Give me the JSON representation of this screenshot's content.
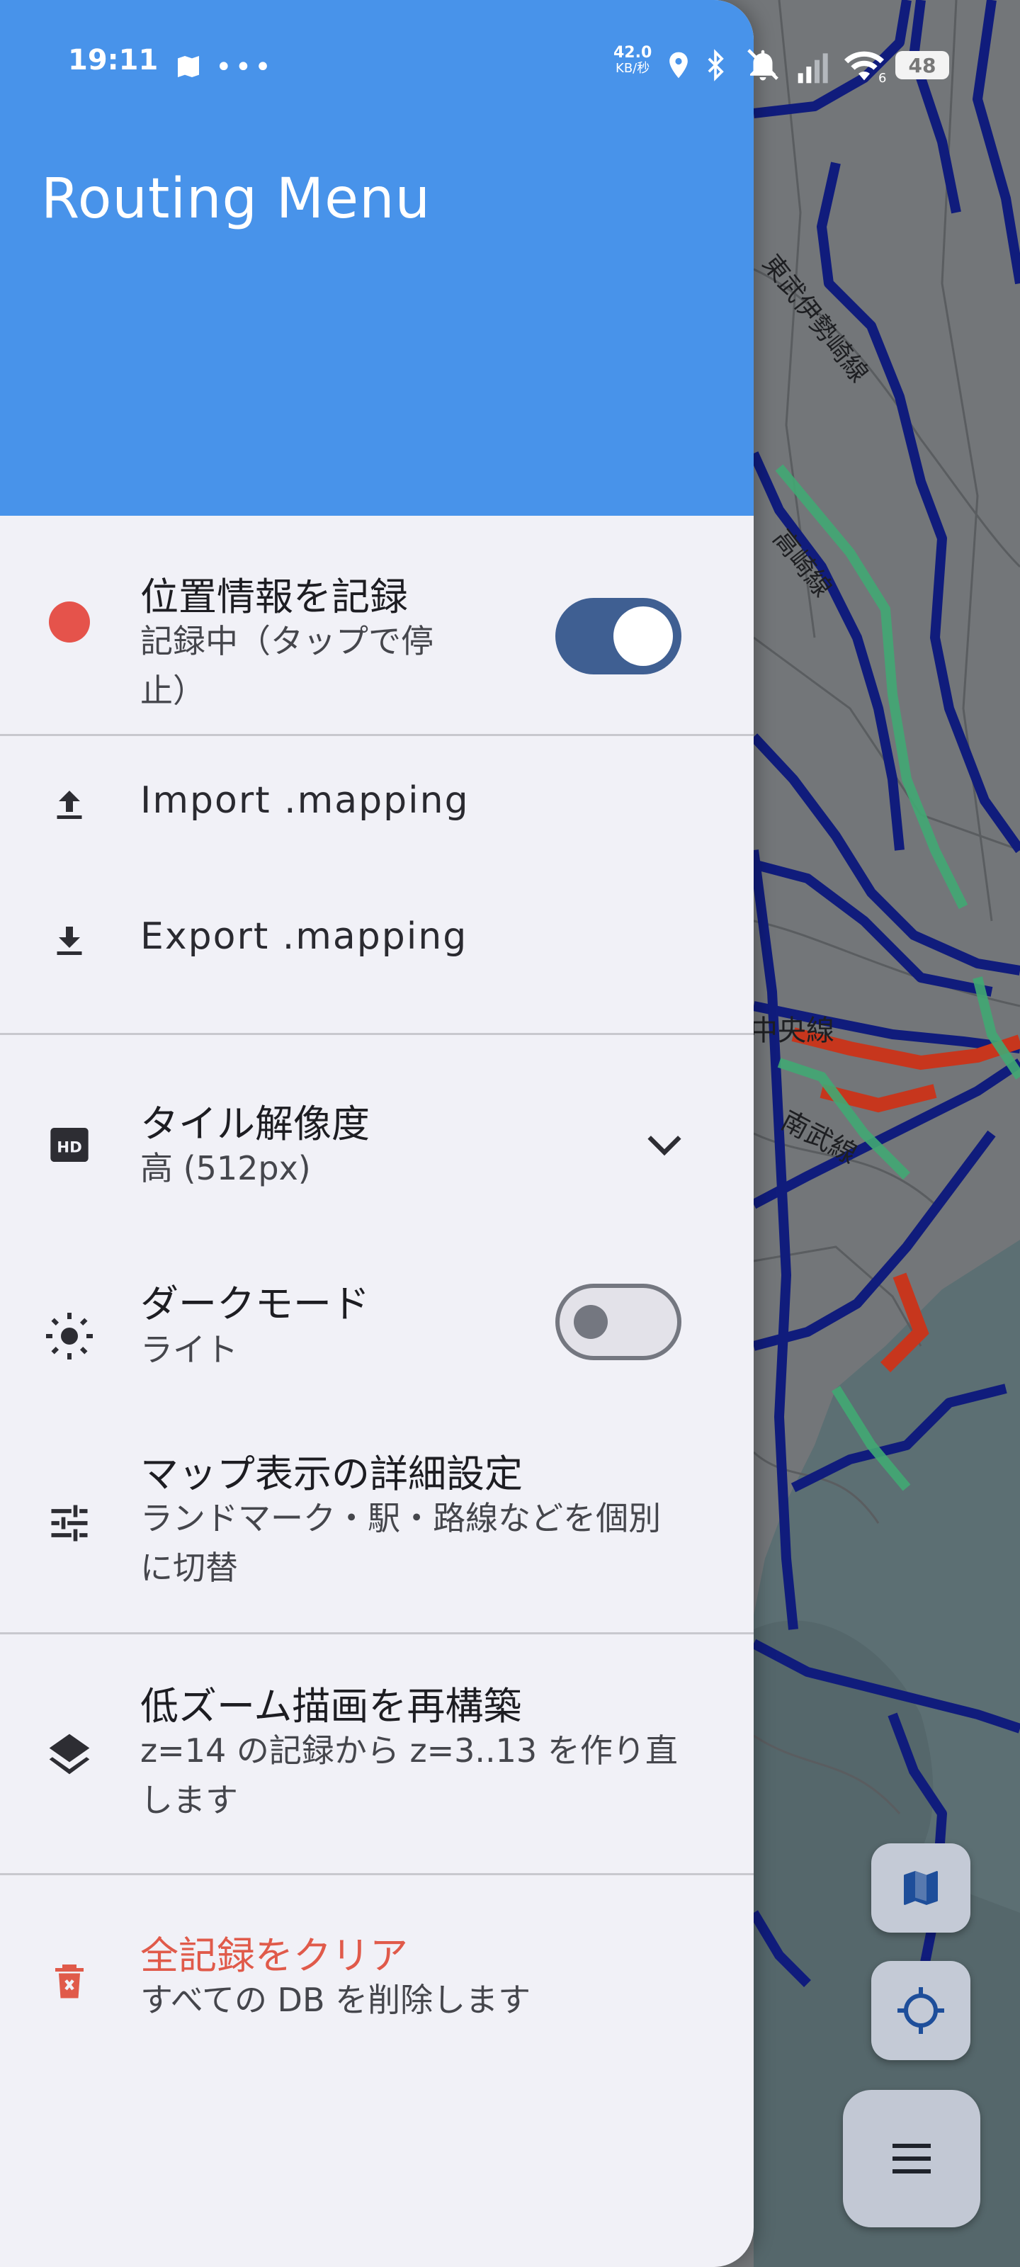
{
  "status_bar": {
    "time": "19:11",
    "net_speed_value": "42.0",
    "net_speed_unit": "KB/秒",
    "battery": "48",
    "wifi_badge": "6"
  },
  "drawer": {
    "title": "Routing Menu",
    "items": [
      {
        "title": "位置情報を記録",
        "subtitle": "記録中（タップで停止）",
        "toggle_on": true
      },
      {
        "label": "Import .mapping"
      },
      {
        "label": "Export .mapping"
      },
      {
        "title": "タイル解像度",
        "subtitle": "高 (512px)"
      },
      {
        "title": "ダークモード",
        "subtitle": "ライト",
        "toggle_on": false
      },
      {
        "title": "マップ表示の詳細設定",
        "subtitle": "ランドマーク・駅・路線などを個別に切替"
      },
      {
        "title": "低ズーム描画を再構築",
        "subtitle": "z=14 の記録から z=3..13 を作り直します"
      },
      {
        "title": "全記録をクリア",
        "subtitle": "すべての DB を削除します"
      }
    ]
  },
  "map": {
    "labels": [
      "東武伊勢崎線",
      "高崎線",
      "中央線",
      "南武線"
    ]
  },
  "icons": {
    "record": "record-dot-icon",
    "import": "upload-icon",
    "export": "download-icon",
    "resolution": "hd-icon",
    "dark_mode": "brightness-icon",
    "map_settings": "tune-icon",
    "rebuild": "layers-icon",
    "clear": "delete-icon",
    "map_button": "map-icon",
    "locate_button": "my-location-icon",
    "menu_button": "menu-icon"
  },
  "colors": {
    "header": "#4893ea",
    "drawer_bg": "#f1f1f7",
    "toggle_on": "#3f5f92",
    "danger": "#e05a4a",
    "record_dot": "#e5534b"
  }
}
